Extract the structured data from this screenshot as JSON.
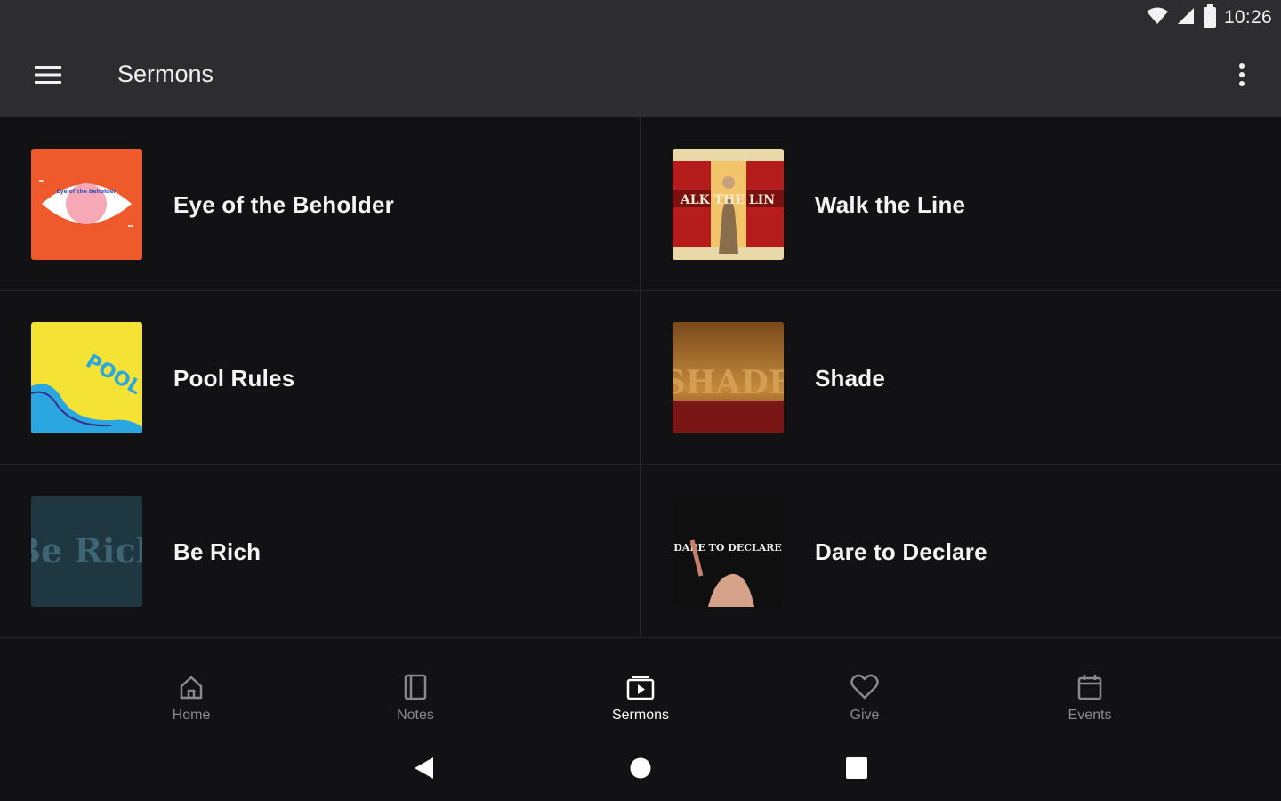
{
  "status_bar": {
    "time": "10:26"
  },
  "app_bar": {
    "title": "Sermons"
  },
  "sermons": [
    {
      "title": "Eye of the Beholder",
      "art_text": "Eye of the Beholder"
    },
    {
      "title": "Walk the Line",
      "art_text": "ALK THE LIN"
    },
    {
      "title": "Pool Rules",
      "art_text": "POOL RULES"
    },
    {
      "title": "Shade",
      "art_text": "SHADE"
    },
    {
      "title": "Be Rich",
      "art_text": "Be Rich"
    },
    {
      "title": "Dare to Declare",
      "art_text": "DARE TO DECLARE"
    }
  ],
  "bottom_nav": {
    "items": [
      {
        "label": "Home",
        "icon": "home-icon"
      },
      {
        "label": "Notes",
        "icon": "notes-icon"
      },
      {
        "label": "Sermons",
        "icon": "sermons-icon",
        "active": true
      },
      {
        "label": "Give",
        "icon": "heart-icon"
      },
      {
        "label": "Events",
        "icon": "calendar-icon"
      }
    ]
  },
  "colors": {
    "background": "#121214",
    "app_bar": "#2d2d2f",
    "active": "#ffffff",
    "inactive": "#8a8a8e"
  }
}
